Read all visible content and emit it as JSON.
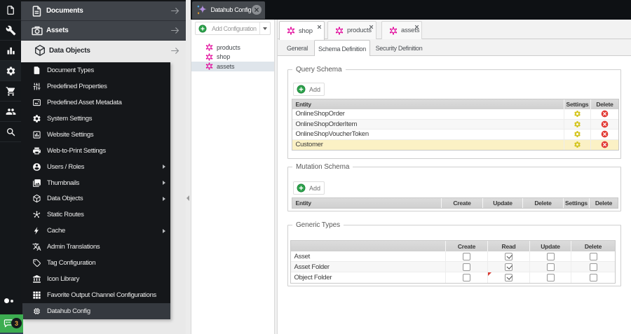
{
  "iconbar": {
    "icons": [
      "document-icon",
      "tools-icon",
      "reports-icon",
      "settings-icon",
      "ecommerce-icon",
      "users-icon",
      "search-icon"
    ],
    "chat_count": "3"
  },
  "menu": {
    "headers": [
      {
        "label": "Documents",
        "icon": "document-stack-icon"
      },
      {
        "label": "Assets",
        "icon": "camera-icon"
      },
      {
        "label": "Data Objects",
        "icon": "cube-icon"
      }
    ],
    "items": [
      {
        "label": "Document Types",
        "icon": "document-type-icon",
        "has_children": false
      },
      {
        "label": "Predefined Properties",
        "icon": "sliders-icon",
        "has_children": false
      },
      {
        "label": "Predefined Asset Metadata",
        "icon": "image-frame-icon",
        "has_children": false
      },
      {
        "label": "System Settings",
        "icon": "gear-icon",
        "has_children": false
      },
      {
        "label": "Website Settings",
        "icon": "bars-box-icon",
        "has_children": false
      },
      {
        "label": "Web-to-Print Settings",
        "icon": "printer-icon",
        "has_children": false
      },
      {
        "label": "Users / Roles",
        "icon": "user-circle-icon",
        "has_children": true
      },
      {
        "label": "Thumbnails",
        "icon": "images-icon",
        "has_children": true
      },
      {
        "label": "Data Objects",
        "icon": "cube-icon",
        "has_children": true
      },
      {
        "label": "Static Routes",
        "icon": "hub-icon",
        "has_children": false
      },
      {
        "label": "Cache",
        "icon": "bolt-icon",
        "has_children": true
      },
      {
        "label": "Admin Translations",
        "icon": "translate-icon",
        "has_children": false
      },
      {
        "label": "Tag Configuration",
        "icon": "tag-icon",
        "has_children": false
      },
      {
        "label": "Icon Library",
        "icon": "bank-icon",
        "has_children": false
      },
      {
        "label": "Favorite Output Channel Configurations",
        "icon": "grid-icon",
        "has_children": false
      },
      {
        "label": "Datahub Config",
        "icon": "chip-icon",
        "has_children": false
      }
    ]
  },
  "window_tab": {
    "label": "Datahub Config",
    "icon": "datahub-sparkle-icon"
  },
  "tree": {
    "add_button_label": "Add Configuration",
    "items": [
      {
        "label": "products",
        "icon": "graphql-icon"
      },
      {
        "label": "shop",
        "icon": "graphql-icon"
      },
      {
        "label": "assets",
        "icon": "graphql-icon"
      }
    ],
    "selected": "assets"
  },
  "tabs": [
    {
      "label": "shop",
      "icon": "graphql-icon",
      "active": true
    },
    {
      "label": "products",
      "icon": "graphql-icon",
      "active": false
    },
    {
      "label": "assets",
      "icon": "graphql-icon",
      "active": false
    }
  ],
  "subtabs": [
    {
      "label": "General",
      "active": false
    },
    {
      "label": "Schema Definition",
      "active": true
    },
    {
      "label": "Security Definition",
      "active": false
    }
  ],
  "query_schema": {
    "legend": "Query Schema",
    "add_label": "Add",
    "columns": [
      "Entity",
      "Settings",
      "Delete"
    ],
    "rows": [
      {
        "entity": "OnlineShopOrder",
        "highlight": false
      },
      {
        "entity": "OnlineShopOrderItem",
        "highlight": false
      },
      {
        "entity": "OnlineShopVoucherToken",
        "highlight": false
      },
      {
        "entity": "Customer",
        "highlight": true
      }
    ]
  },
  "mutation_schema": {
    "legend": "Mutation Schema",
    "add_label": "Add",
    "columns": [
      "Entity",
      "Create",
      "Update",
      "Delete",
      "Settings",
      "Delete"
    ],
    "rows": []
  },
  "generic_types": {
    "legend": "Generic Types",
    "columns": [
      "",
      "Create",
      "Read",
      "Update",
      "Delete"
    ],
    "rows": [
      {
        "label": "Asset",
        "create": false,
        "read": true,
        "update": false,
        "delete": false,
        "dirty": null
      },
      {
        "label": "Asset Folder",
        "create": false,
        "read": true,
        "update": false,
        "delete": false,
        "dirty": null
      },
      {
        "label": "Object Folder",
        "create": false,
        "read": true,
        "update": false,
        "delete": false,
        "dirty": "read"
      }
    ]
  },
  "colors": {
    "graphql_pink": "#e10098",
    "add_green": "#2a9d47",
    "settings_yellow": "#d3c41d",
    "delete_red": "#e23b35",
    "highlight_row": "#fbf1c5",
    "chat_green": "#3dad51"
  }
}
